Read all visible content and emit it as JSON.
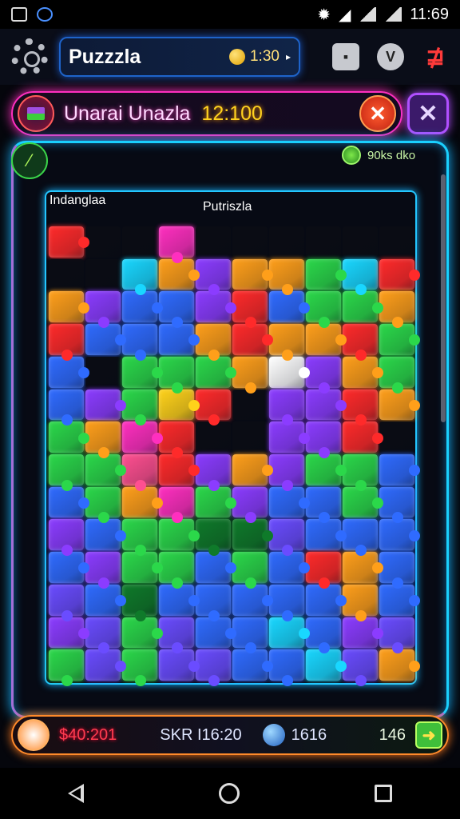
{
  "status_bar": {
    "time": "11:69"
  },
  "top_bar": {
    "title": "Puzzzla",
    "coins": "1:30"
  },
  "level_header": {
    "title": "Unarai Unazla",
    "score": "12:100"
  },
  "board": {
    "pieces_counter": "90ks dko",
    "label_left": "Indanglaa",
    "label_center": "Putriszla",
    "colors": {
      "cyan": "#19d7ff",
      "blue": "#2f6bff",
      "purple": "#8b3cff",
      "violet": "#6a4cff",
      "green": "#2bd84a",
      "lime": "#58f03a",
      "orange": "#ff9f1a",
      "yellow": "#ffd21a",
      "red": "#ff2a2a",
      "magenta": "#ff2fbf",
      "pink": "#ff4f90",
      "dark": "#0a0c14",
      "white": "#ffffff",
      "teal": "#1ab7c8",
      "darkgreen": "#0f7a2a"
    },
    "rows": [
      [
        "red",
        "dark",
        "dark",
        "magenta",
        "dark",
        "dark",
        "dark",
        "dark",
        "dark",
        "dark"
      ],
      [
        "dark",
        "dark",
        "cyan",
        "orange",
        "purple",
        "orange",
        "orange",
        "green",
        "cyan",
        "red"
      ],
      [
        "orange",
        "purple",
        "blue",
        "blue",
        "purple",
        "red",
        "blue",
        "green",
        "green",
        "orange"
      ],
      [
        "red",
        "blue",
        "blue",
        "blue",
        "orange",
        "red",
        "orange",
        "orange",
        "red",
        "green"
      ],
      [
        "blue",
        "dark",
        "green",
        "green",
        "green",
        "orange",
        "white",
        "purple",
        "orange",
        "green"
      ],
      [
        "blue",
        "purple",
        "green",
        "yellow",
        "red",
        "dark",
        "purple",
        "purple",
        "red",
        "orange"
      ],
      [
        "green",
        "orange",
        "magenta",
        "red",
        "dark",
        "dark",
        "purple",
        "purple",
        "red",
        "dark"
      ],
      [
        "green",
        "green",
        "pink",
        "red",
        "purple",
        "orange",
        "purple",
        "green",
        "green",
        "blue"
      ],
      [
        "blue",
        "green",
        "orange",
        "magenta",
        "green",
        "purple",
        "blue",
        "blue",
        "green",
        "blue"
      ],
      [
        "purple",
        "blue",
        "green",
        "green",
        "darkgreen",
        "darkgreen",
        "violet",
        "blue",
        "blue",
        "blue"
      ],
      [
        "blue",
        "purple",
        "green",
        "green",
        "blue",
        "green",
        "blue",
        "red",
        "orange",
        "blue"
      ],
      [
        "violet",
        "blue",
        "darkgreen",
        "blue",
        "blue",
        "blue",
        "blue",
        "blue",
        "orange",
        "blue"
      ],
      [
        "purple",
        "violet",
        "green",
        "violet",
        "blue",
        "blue",
        "cyan",
        "blue",
        "purple",
        "violet"
      ],
      [
        "green",
        "violet",
        "green",
        "violet",
        "violet",
        "blue",
        "blue",
        "cyan",
        "violet",
        "orange"
      ]
    ]
  },
  "bottom_bar": {
    "money": "$40:201",
    "time_label": "SKR I16:20",
    "count": "1616",
    "moves": "146"
  }
}
